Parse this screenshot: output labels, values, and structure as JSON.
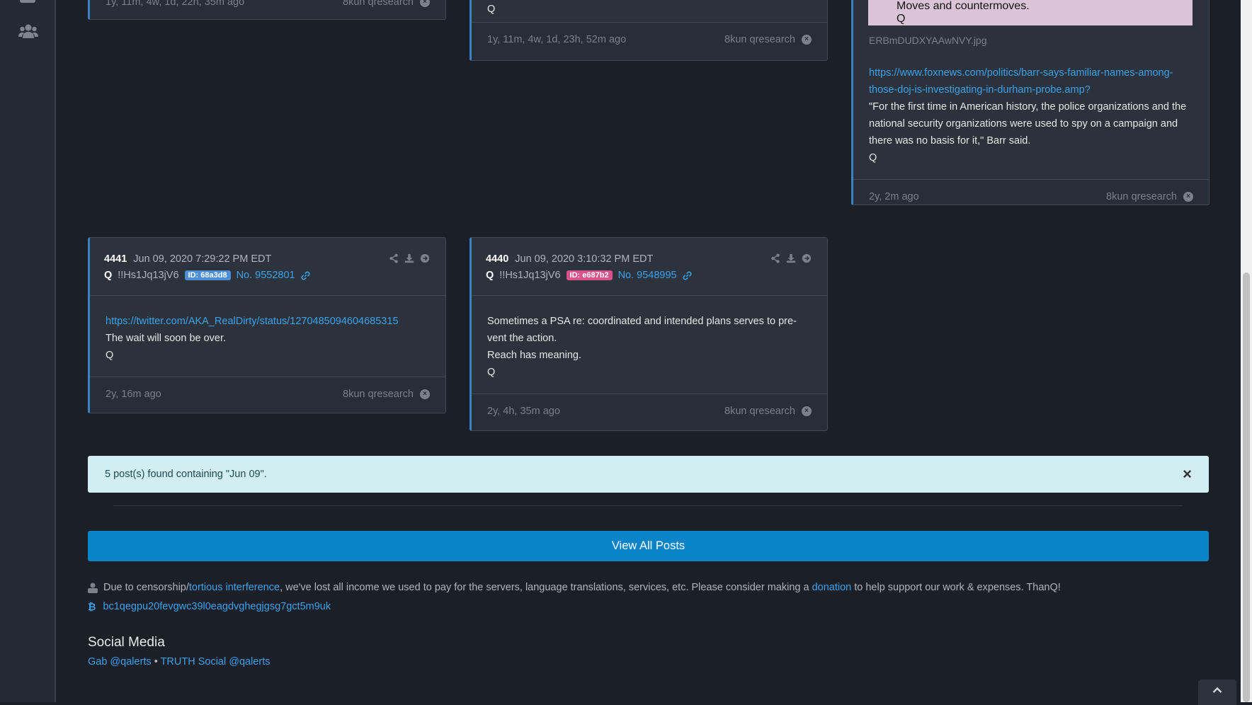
{
  "cards_top": {
    "left_footer_time": "1y, 11m, 4w, 1d, 22h, 35m ago",
    "left_footer_source": "8kun qresearch",
    "middle_body_sign": "Q",
    "middle_footer_time": "1y, 11m, 4w, 1d, 23h, 52m ago",
    "middle_footer_source": "8kun qresearch",
    "right_image_text_1": "Moves and countermoves.",
    "right_image_text_2": "Q",
    "right_image_filename": "ERBmDUDXYAAwNVY.jpg",
    "right_link": "https://www.foxnews.com/politics/barr-says-familiar-names-among-those-doj-is-investigating-in-durham-probe.amp?",
    "right_quote": "\"For the first time in American history, the police organizations and the national security organizations were used to spy on a campaign and there was no basis for it,\" Barr said.",
    "right_sign": "Q",
    "right_footer_time": "2y, 2m ago",
    "right_footer_source": "8kun qresearch"
  },
  "posts": [
    {
      "number": "4441",
      "date": "Jun 09, 2020 7:29:22 PM EDT",
      "author": "Q",
      "tripcode": "!!Hs1Jq13jV6",
      "id_badge": "ID: 68a3d8",
      "badge_color": "#4c8fd6",
      "post_no": "No. 9552801",
      "link": "https://twitter.com/AKA_RealDirty/status/1270485094604685315",
      "lines": [
        "The wait will soon be over.",
        "Q"
      ],
      "footer_time": "2y, 16m ago",
      "footer_source": "8kun qresearch"
    },
    {
      "number": "4440",
      "date": "Jun 09, 2020 3:10:32 PM EDT",
      "author": "Q",
      "tripcode": "!!Hs1Jq13jV6",
      "id_badge": "ID: e687b2",
      "badge_color": "#d8528a",
      "post_no": "No. 9548995",
      "lines": [
        "Sometimes a PSA re: coordinated and intended plans serves to pre-vent the action.",
        "Reach has meaning.",
        "Q"
      ],
      "footer_time": "2y, 4h, 35m ago",
      "footer_source": "8kun qresearch"
    }
  ],
  "alert": {
    "text": "5 post(s) found containing \"Jun 09\".",
    "close": "×"
  },
  "view_all": "View All Posts",
  "footer": {
    "pre": "Due to censorship/",
    "link1": "tortious interference",
    "mid": ", we've lost all income we used to pay for the servers, language translations, services, etc. Please consider making a ",
    "link2": "donation",
    "post": " to help support our work & expenses. ThanQ!",
    "btc_address": "bc1qegpu20fevgwc39l0eagdvghegjgsg7gct5m9uk"
  },
  "social": {
    "title": "Social Media",
    "gab": "Gab @qalerts",
    "sep": " • ",
    "truth": "TRUTH Social @qalerts"
  },
  "colors": {
    "accent": "#0a84c9",
    "link": "#3aa2ee",
    "alert_bg": "#d2eef2"
  }
}
